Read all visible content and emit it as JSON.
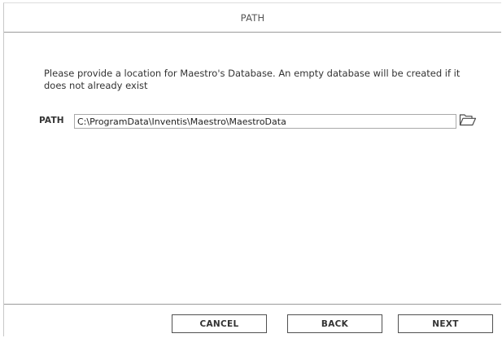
{
  "header": {
    "title": "PATH"
  },
  "content": {
    "instruction": "Please provide a location for Maestro's Database. An empty database will be created if it does not already exist",
    "path_label": "PATH",
    "path_value": "C:\\ProgramData\\Inventis\\Maestro\\MaestroData",
    "browse_icon": "folder-open-icon"
  },
  "footer": {
    "cancel_label": "CANCEL",
    "back_label": "BACK",
    "next_label": "NEXT"
  }
}
